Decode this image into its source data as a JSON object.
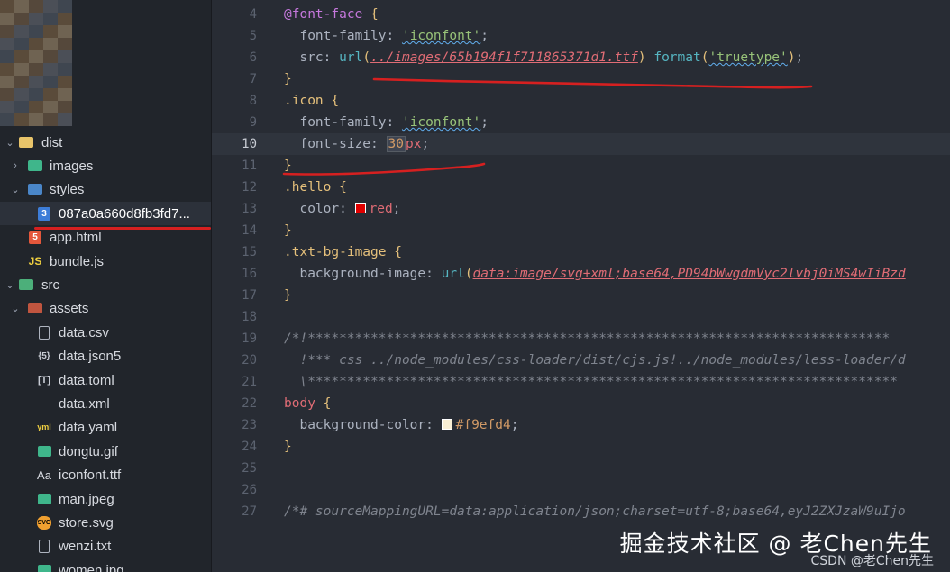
{
  "sidebar": {
    "items": [
      {
        "label": "dist",
        "icon": "folder-icon",
        "chevron": "⌄"
      },
      {
        "label": "images",
        "icon": "images-folder-icon",
        "chevron": "›"
      },
      {
        "label": "styles",
        "icon": "styles-folder-icon",
        "chevron": "⌄"
      },
      {
        "label": "087a0a660d8fb3fd7...",
        "icon": "css-file-icon",
        "chevron": ""
      },
      {
        "label": "app.html",
        "icon": "html-file-icon",
        "chevron": ""
      },
      {
        "label": "bundle.js",
        "icon": "js-file-icon",
        "chevron": ""
      },
      {
        "label": "src",
        "icon": "src-folder-icon",
        "chevron": "⌄"
      },
      {
        "label": "assets",
        "icon": "assets-folder-icon",
        "chevron": "⌄"
      },
      {
        "label": "data.csv",
        "icon": "document-file-icon",
        "chevron": ""
      },
      {
        "label": "data.json5",
        "icon": "json-file-icon",
        "chevron": ""
      },
      {
        "label": "data.toml",
        "icon": "toml-file-icon",
        "chevron": ""
      },
      {
        "label": "data.xml",
        "icon": "xml-file-icon",
        "chevron": ""
      },
      {
        "label": "data.yaml",
        "icon": "yaml-file-icon",
        "chevron": ""
      },
      {
        "label": "dongtu.gif",
        "icon": "image-file-icon",
        "chevron": ""
      },
      {
        "label": "iconfont.ttf",
        "icon": "font-file-icon",
        "chevron": ""
      },
      {
        "label": "man.jpeg",
        "icon": "image-file-icon",
        "chevron": ""
      },
      {
        "label": "store.svg",
        "icon": "svg-file-icon",
        "chevron": ""
      },
      {
        "label": "wenzi.txt",
        "icon": "text-file-icon",
        "chevron": ""
      },
      {
        "label": "women.jpg",
        "icon": "image-file-icon",
        "chevron": ""
      }
    ],
    "icon_glyphs": {
      "css_badge": "3",
      "html_badge": "5",
      "js_badge": "JS",
      "json_badge": "{5}",
      "toml_badge": "[T]",
      "xml_badge": "</>",
      "yaml_badge": "yml",
      "font_badge": "Aa",
      "svg_badge": "SVG"
    }
  },
  "editor": {
    "lines": [
      {
        "n": "4",
        "tokens": [
          {
            "t": "@font-face",
            "c": "kw"
          },
          {
            "t": " "
          },
          {
            "t": "{",
            "c": "brace"
          }
        ]
      },
      {
        "n": "5",
        "tokens": [
          {
            "t": "  font-family",
            "c": "prop"
          },
          {
            "t": ": "
          },
          {
            "t": "'iconfont'",
            "c": "str squig"
          },
          {
            "t": ";"
          }
        ]
      },
      {
        "n": "6",
        "tokens": [
          {
            "t": "  src",
            "c": "prop"
          },
          {
            "t": ": "
          },
          {
            "t": "url",
            "c": "fn"
          },
          {
            "t": "(",
            "c": "brace"
          },
          {
            "t": "../images/65b194f1f711865371d1.ttf",
            "c": "url"
          },
          {
            "t": ")",
            "c": "brace"
          },
          {
            "t": " "
          },
          {
            "t": "format",
            "c": "fn"
          },
          {
            "t": "(",
            "c": "brace"
          },
          {
            "t": "'truetype'",
            "c": "str squig"
          },
          {
            "t": ")",
            "c": "brace"
          },
          {
            "t": ";"
          }
        ]
      },
      {
        "n": "7",
        "tokens": [
          {
            "t": "}",
            "c": "brace"
          }
        ]
      },
      {
        "n": "8",
        "tokens": [
          {
            "t": ".icon",
            "c": "sel"
          },
          {
            "t": " "
          },
          {
            "t": "{",
            "c": "brace"
          }
        ]
      },
      {
        "n": "9",
        "tokens": [
          {
            "t": "  font-family",
            "c": "prop"
          },
          {
            "t": ": "
          },
          {
            "t": "'iconfont'",
            "c": "str squig"
          },
          {
            "t": ";"
          }
        ]
      },
      {
        "n": "10",
        "current": true,
        "tokens": [
          {
            "t": "  font-size",
            "c": "prop"
          },
          {
            "t": ": "
          },
          {
            "t": "30",
            "c": "num numbox"
          },
          {
            "t": "px",
            "c": "unit"
          },
          {
            "t": ";"
          }
        ]
      },
      {
        "n": "11",
        "tokens": [
          {
            "t": "}",
            "c": "brace"
          }
        ]
      },
      {
        "n": "12",
        "tokens": [
          {
            "t": ".hello",
            "c": "sel"
          },
          {
            "t": " "
          },
          {
            "t": "{",
            "c": "brace"
          }
        ]
      },
      {
        "n": "13",
        "tokens": [
          {
            "t": "  color",
            "c": "prop"
          },
          {
            "t": ": "
          },
          {
            "swatch": "#e00000"
          },
          {
            "t": "red",
            "c": "val"
          },
          {
            "t": ";"
          }
        ]
      },
      {
        "n": "14",
        "tokens": [
          {
            "t": "}",
            "c": "brace"
          }
        ]
      },
      {
        "n": "15",
        "tokens": [
          {
            "t": ".txt-bg-image",
            "c": "sel"
          },
          {
            "t": " "
          },
          {
            "t": "{",
            "c": "brace"
          }
        ]
      },
      {
        "n": "16",
        "tokens": [
          {
            "t": "  background-image",
            "c": "prop"
          },
          {
            "t": ": "
          },
          {
            "t": "url",
            "c": "fn"
          },
          {
            "t": "(",
            "c": "brace"
          },
          {
            "t": "data:image/svg+xml;base64,PD94bWwgdmVyc2lvbj0iMS4wIiBzd",
            "c": "url"
          }
        ]
      },
      {
        "n": "17",
        "tokens": [
          {
            "t": "}",
            "c": "brace"
          }
        ]
      },
      {
        "n": "18",
        "tokens": []
      },
      {
        "n": "19",
        "tokens": [
          {
            "t": "/*!**************************************************************************",
            "c": "cmt"
          }
        ]
      },
      {
        "n": "20",
        "tokens": [
          {
            "t": "  !*** css ../node_modules/css-loader/dist/cjs.js!../node_modules/less-loader/d",
            "c": "cmt"
          }
        ]
      },
      {
        "n": "21",
        "tokens": [
          {
            "t": "  \\***************************************************************************",
            "c": "cmt"
          }
        ]
      },
      {
        "n": "22",
        "tokens": [
          {
            "t": "body",
            "c": "val"
          },
          {
            "t": " "
          },
          {
            "t": "{",
            "c": "brace"
          }
        ]
      },
      {
        "n": "23",
        "tokens": [
          {
            "t": "  background-color",
            "c": "prop"
          },
          {
            "t": ": "
          },
          {
            "swatch": "#f9efd4"
          },
          {
            "t": "#f9efd4",
            "c": "num"
          },
          {
            "t": ";"
          }
        ]
      },
      {
        "n": "24",
        "tokens": [
          {
            "t": "}",
            "c": "brace"
          }
        ]
      },
      {
        "n": "25",
        "tokens": []
      },
      {
        "n": "26",
        "tokens": []
      },
      {
        "n": "27",
        "tokens": [
          {
            "t": "/*# sourceMappingURL=data:application/json;charset=utf-8;base64,eyJ2ZXJzaW9uIjo",
            "c": "cmt"
          }
        ]
      }
    ]
  },
  "watermark": {
    "main": "掘金技术社区 @ 老Chen先生",
    "sub": "CSDN @老Chen先生"
  },
  "colors": {
    "annotation_red": "#d62020",
    "editor_bg": "#282c34",
    "sidebar_bg": "#21252b"
  }
}
